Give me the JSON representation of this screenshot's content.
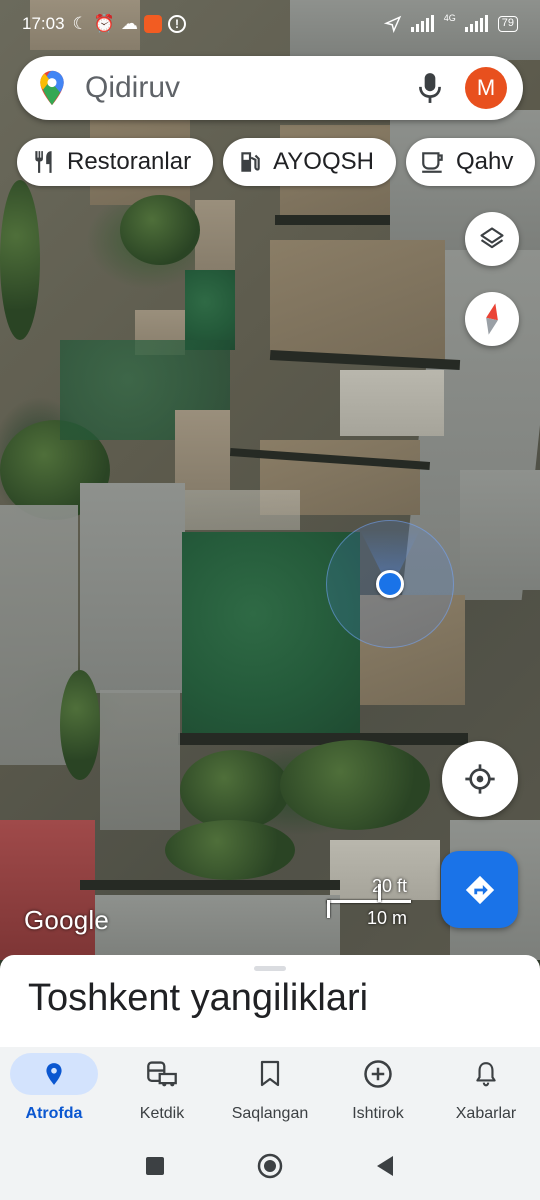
{
  "status_bar": {
    "time": "17:03",
    "network": "4G",
    "battery": "79"
  },
  "search": {
    "placeholder": "Qidiruv",
    "avatar_letter": "M"
  },
  "chips": [
    {
      "icon": "fork-knife-icon",
      "label": "Restoranlar"
    },
    {
      "icon": "gas-pump-icon",
      "label": "AYOQSH"
    },
    {
      "icon": "coffee-cup-icon",
      "label": "Qahv"
    }
  ],
  "map": {
    "logo": "Google",
    "scale_imperial": "20 ft",
    "scale_metric": "10 m"
  },
  "sheet": {
    "title": "Toshkent yangiliklari"
  },
  "bottom_nav": [
    {
      "icon": "location-pin-icon",
      "label": "Atrofda",
      "active": true
    },
    {
      "icon": "commute-icon",
      "label": "Ketdik",
      "active": false
    },
    {
      "icon": "bookmark-icon",
      "label": "Saqlangan",
      "active": false
    },
    {
      "icon": "add-circle-icon",
      "label": "Ishtirok",
      "active": false
    },
    {
      "icon": "bell-icon",
      "label": "Xabarlar",
      "active": false
    }
  ],
  "colors": {
    "accent": "#1a73e8",
    "avatar_bg": "#e8501e",
    "active_pill": "#d3e3fd",
    "active_label": "#0b57d0"
  }
}
